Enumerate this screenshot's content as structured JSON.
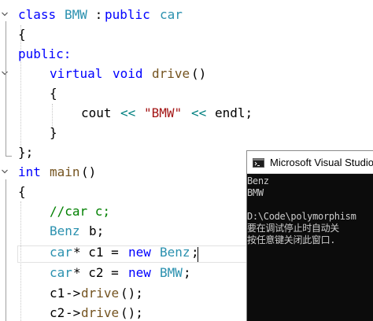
{
  "editor": {
    "lines": {
      "l1": {
        "kw_class": "class",
        "name": "BMW",
        "sep": " :",
        "kw_public": "public",
        "base": "car"
      },
      "l2": {
        "brace": "{"
      },
      "l3": {
        "label": "public:"
      },
      "l4": {
        "kw_virtual": "virtual",
        "kw_void": "void",
        "fn": "drive",
        "parens": "()"
      },
      "l5": {
        "brace": "{"
      },
      "l6": {
        "cout": "cout",
        "op1": "<<",
        "str": "\"BMW\"",
        "op2": "<<",
        "endl": "endl;"
      },
      "l7": {
        "brace": "}"
      },
      "l8": {
        "brace": "};"
      },
      "l9": {
        "kw_int": "int",
        "fn": "main",
        "parens": "()"
      },
      "l10": {
        "brace": "{"
      },
      "l11": {
        "comment": "//car c;"
      },
      "l12": {
        "type": "Benz",
        "rest": "b;"
      },
      "l13": {
        "type": "car",
        "ptr": "* c1 = ",
        "kw_new": "new",
        "type2": "Benz",
        "end": ";"
      },
      "l14": {
        "type": "car",
        "ptr": "* c2 = ",
        "kw_new": "new",
        "type2": "BMW",
        "end": ";"
      },
      "l15": {
        "var": "c1",
        "arrow": "->",
        "fn": "drive",
        "end": "();"
      },
      "l16": {
        "var": "c2",
        "arrow": "->",
        "fn": "drive",
        "end": "();"
      }
    }
  },
  "console": {
    "title": "Microsoft Visual Studio",
    "icon": "console-app-icon",
    "output": [
      "Benz",
      "BMW",
      "",
      "D:\\Code\\polymorphism",
      "要在调试停止时自动关",
      "按任意键关闭此窗口."
    ]
  },
  "colors": {
    "keyword": "#0000ff",
    "type": "#2b91af",
    "function": "#74531f",
    "string": "#a31515",
    "comment": "#008000",
    "console_bg": "#0c0c0c",
    "console_fg": "#cccccc"
  }
}
